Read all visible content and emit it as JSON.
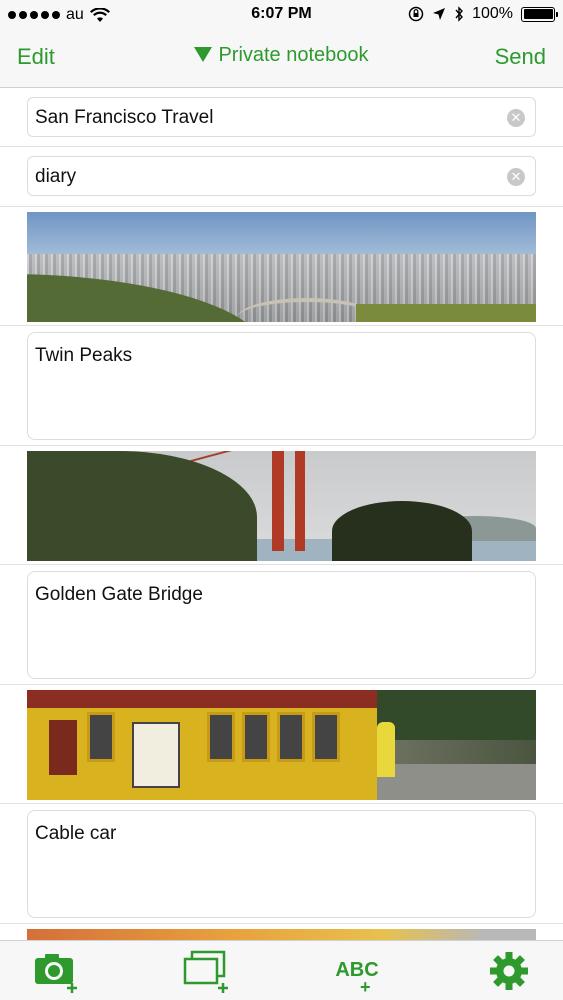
{
  "status_bar": {
    "carrier": "au",
    "time": "6:07 PM",
    "battery": "100%"
  },
  "nav": {
    "edit_label": "Edit",
    "title": "Private notebook",
    "send_label": "Send"
  },
  "fields": {
    "title_value": "San Francisco Travel",
    "tag_value": "diary"
  },
  "entries": [
    {
      "caption": "Twin Peaks"
    },
    {
      "caption": "Golden Gate Bridge"
    },
    {
      "caption": "Cable car"
    }
  ],
  "toolbar": {
    "camera_icon": "camera-add-icon",
    "photos_icon": "photos-add-icon",
    "text_label": "ABC",
    "text_plus": "+",
    "settings_icon": "gear-icon"
  },
  "colors": {
    "accent": "#2e9a2e"
  }
}
